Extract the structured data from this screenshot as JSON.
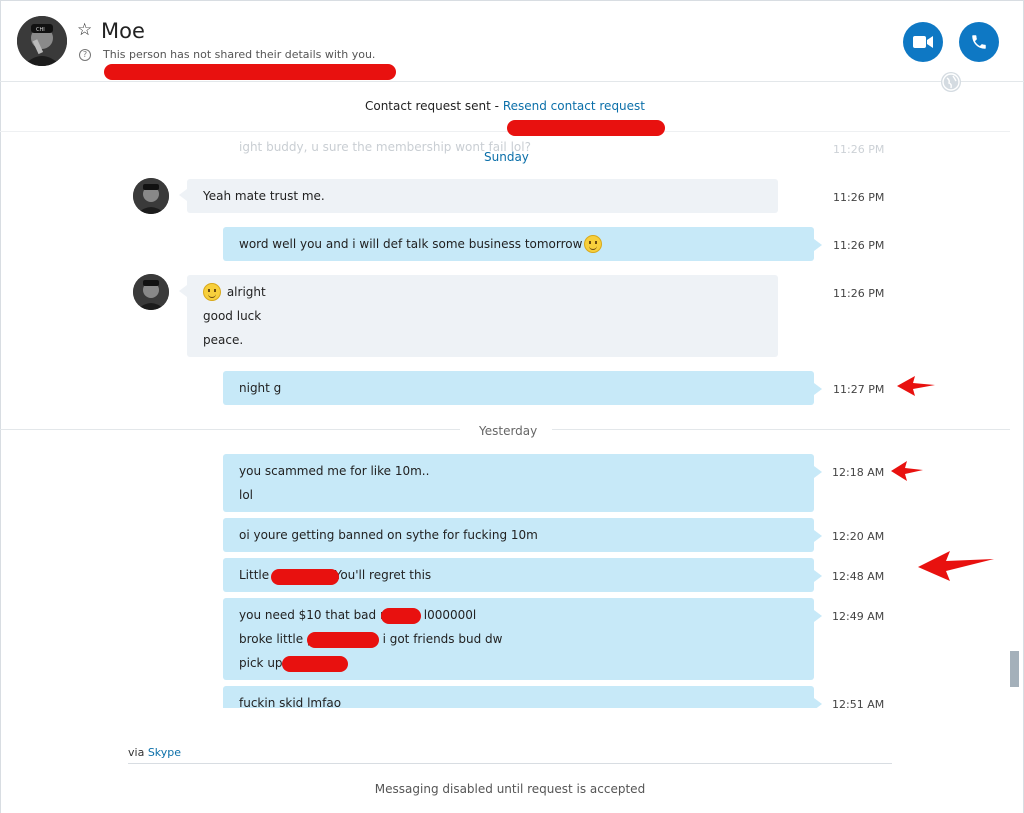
{
  "header": {
    "contact_name": "Moe",
    "details_note": "This person has not shared their details with you.",
    "star_icon": "star-outline-icon",
    "info_icon": "question-circle-icon",
    "video_icon": "video-camera-icon",
    "call_icon": "phone-icon",
    "globe_icon": "globe-icon",
    "accent_color": "#0e78c4"
  },
  "request_bar": {
    "sent_text": "Contact request sent - ",
    "resend_link": "Resend contact request"
  },
  "faded_previous": {
    "text": "ight buddy, u sure the membership wont fail lol?",
    "time": "11:26 PM"
  },
  "day_labels": {
    "sunday": "Sunday",
    "yesterday": "Yesterday"
  },
  "messages": [
    {
      "direction": "incoming",
      "lines": [
        "Yeah mate trust me."
      ],
      "time": "11:26 PM"
    },
    {
      "direction": "outgoing",
      "lines": [
        "word well you and i will def talk some business tomorrow"
      ],
      "emoji": "smile-emoji",
      "time": "11:26 PM"
    },
    {
      "direction": "incoming",
      "lines": [
        "alright",
        "good luck",
        "peace."
      ],
      "emoji": "smile-emoji",
      "time": "11:26 PM"
    },
    {
      "direction": "outgoing",
      "lines": [
        "night g"
      ],
      "time": "11:27 PM"
    },
    {
      "direction": "outgoing",
      "lines": [
        "you scammed me for like 10m..",
        "lol"
      ],
      "time": "12:18 AM"
    },
    {
      "direction": "outgoing",
      "lines": [
        "oi youre getting banned on sythe for fucking 10m"
      ],
      "time": "12:20 AM"
    },
    {
      "direction": "outgoing",
      "lines": [
        "Little p",
        "You'll regret this"
      ],
      "time": "12:48 AM"
    },
    {
      "direction": "outgoing",
      "lines": [
        "you need $10 that bad n",
        "? l000000l",
        "broke little p",
        "i got friends bud dw",
        "pick up"
      ],
      "time": "12:49 AM"
    },
    {
      "direction": "outgoing",
      "lines": [
        "fuckin skid lmfao"
      ],
      "time": "12:51 AM"
    }
  ],
  "footer": {
    "via_prefix": "via ",
    "via_link": "Skype",
    "disabled_note": "Messaging disabled until request is accepted"
  },
  "annotation_color": "#e8110f"
}
